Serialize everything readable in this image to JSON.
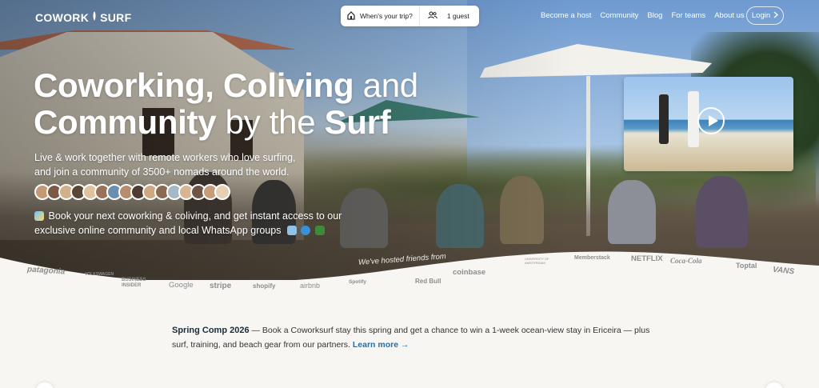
{
  "brand": {
    "name_a": "COWORK",
    "name_b": "SURF"
  },
  "search": {
    "when_placeholder": "When's your trip?",
    "guests": "1 guest"
  },
  "nav": {
    "links": [
      "Become a host",
      "Community",
      "Blog",
      "For teams",
      "About us"
    ],
    "login": "Login"
  },
  "hero": {
    "headline_bold_1": "Coworking, Coliving",
    "headline_light_1": " and",
    "headline_bold_2": "Community",
    "headline_light_2": " by the ",
    "headline_bold_3": "Surf",
    "sub_line_1": "Live & work together with remote workers who love surfing,",
    "sub_line_2": "and join a community of 3500+ nomads around the world.",
    "book_line_1": "Book your next coworking & coliving, and get instant access to our",
    "book_line_2": "exclusive online community and local WhatsApp groups"
  },
  "hosted_label": "We've hosted friends from",
  "logos": [
    "patagonia",
    "VOLKSWAGEN",
    "BUSINESS INSIDER",
    "Google",
    "stripe",
    "shopify",
    "airbnb",
    "Spotify",
    "Red Bull",
    "coinbase",
    "UNIVERSITY OF AMSTERDAM",
    "Memberstack",
    "NETFLIX",
    "Coca-Cola",
    "Toptal",
    "VANS"
  ],
  "promo": {
    "title": "Spring Comp 2026",
    "dash": " — ",
    "text": "Book a Coworksurf stay this spring and get a chance to win a 1-week ocean-view stay in Ericeira — plus surf, training, and beach gear from our partners. ",
    "learn_more": "Learn more →"
  },
  "colors": {
    "accent": "#1f6fb2",
    "background": "#f7f6f3",
    "logo_gray": "#8d8d8d"
  }
}
